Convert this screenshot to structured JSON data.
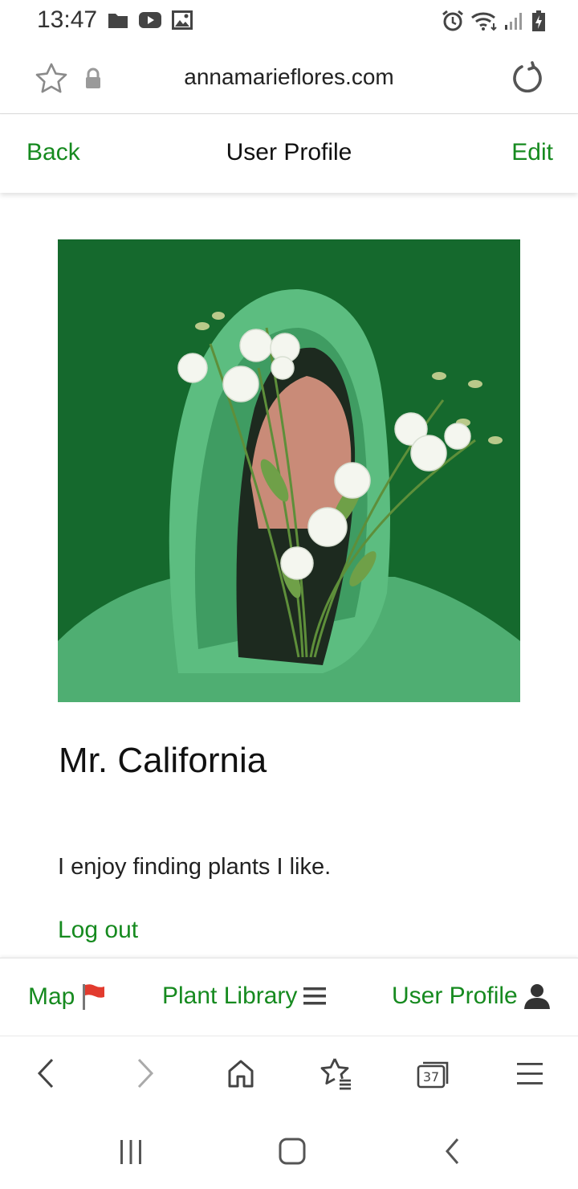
{
  "status_bar": {
    "time": "13:47",
    "left_icons": [
      "folder-icon",
      "youtube-icon",
      "image-icon"
    ],
    "right_icons": [
      "alarm-icon",
      "wifi-icon",
      "signal-icon",
      "battery-charging-icon"
    ]
  },
  "browser": {
    "url": "annamarieflores.com",
    "tabs_count": "37"
  },
  "header": {
    "back_label": "Back",
    "title": "User Profile",
    "edit_label": "Edit"
  },
  "profile": {
    "name": "Mr. California",
    "bio": "I enjoy finding plants I like.",
    "logout_label": "Log out"
  },
  "bottom_nav": {
    "map_label": "Map",
    "library_label": "Plant Library",
    "profile_label": "User Profile"
  },
  "colors": {
    "accent": "#168a1f",
    "photo_background": "#15692d",
    "hoodie": "#4fae72"
  }
}
